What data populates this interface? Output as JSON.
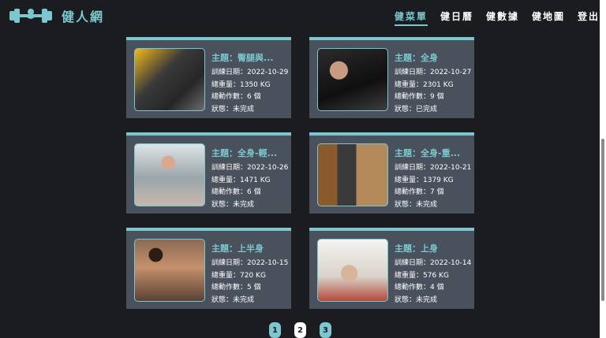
{
  "header": {
    "brand": "健人網",
    "logo_icon": "dumbbell-icon",
    "nav": [
      {
        "label": "健菜單",
        "active": true
      },
      {
        "label": "健日曆",
        "active": false
      },
      {
        "label": "健數據",
        "active": false
      },
      {
        "label": "健地圖",
        "active": false
      },
      {
        "label": "登出",
        "active": false
      }
    ]
  },
  "accent_color": "#7cc7cf",
  "cards": [
    {
      "title": "主題：臀腿與...",
      "date": "訓練日期：2022-10-29",
      "weight": "總重量：1350 KG",
      "exercises": "總動作數：6 個",
      "status": "狀態：未完成"
    },
    {
      "title": "主題：全身",
      "date": "訓練日期：2022-10-27",
      "weight": "總重量：2301 KG",
      "exercises": "總動作數：9 個",
      "status": "狀態：已完成"
    },
    {
      "title": "主題：全身-輕...",
      "date": "訓練日期：2022-10-26",
      "weight": "總重量：1471 KG",
      "exercises": "總動作數：6 個",
      "status": "狀態：未完成"
    },
    {
      "title": "主題：全身-重...",
      "date": "訓練日期：2022-10-21",
      "weight": "總重量：1379 KG",
      "exercises": "總動作數：7 個",
      "status": "狀態：未完成"
    },
    {
      "title": "主題：上半身",
      "date": "訓練日期：2022-10-15",
      "weight": "總重量：720 KG",
      "exercises": "總動作數：5 個",
      "status": "狀態：未完成"
    },
    {
      "title": "主題：上身",
      "date": "訓練日期：2022-10-14",
      "weight": "總重量：576 KG",
      "exercises": "總動作數：4 個",
      "status": "狀態：未完成"
    }
  ],
  "pagination": {
    "pages": [
      "1",
      "2",
      "3"
    ],
    "current": "2"
  }
}
